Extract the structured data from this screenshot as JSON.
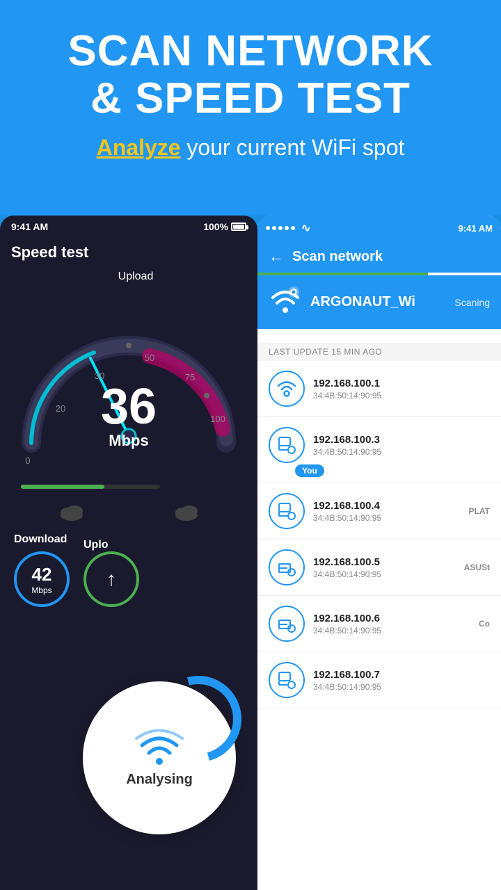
{
  "banner": {
    "title_line1": "SCAN NETWORK",
    "title_line2": "& SPEED TEST",
    "subtitle_highlight": "Analyze",
    "subtitle_rest": " your current WiFi spot"
  },
  "left_phone": {
    "status_time": "9:41 AM",
    "status_battery": "100%",
    "header": "Speed test",
    "upload_label": "Upload",
    "speed_value": "36",
    "speed_unit": "Mbps",
    "download_label": "Download",
    "download_value": "42",
    "download_unit": "Mbps",
    "upload_section_label": "Uplo",
    "analysing_text": "Analysing"
  },
  "right_phone": {
    "status_time": "9:41 AM",
    "header_title": "Scan network",
    "network_name": "ARGONAUT_Wi",
    "scanning_status": "Scaning",
    "last_update": "LAST UPDATE 15 MIN AGO",
    "devices": [
      {
        "ip": "192.168.100.1",
        "mac": "34:4B:50:14:90:95",
        "tag": "",
        "type": "router",
        "you": false
      },
      {
        "ip": "192.168.100.3",
        "mac": "34:4B:50:14:90:95",
        "tag": "",
        "type": "computer",
        "you": true
      },
      {
        "ip": "192.168.100.4",
        "mac": "34:4B:50:14:90:95",
        "tag": "PLAT",
        "type": "computer",
        "you": false
      },
      {
        "ip": "192.168.100.5",
        "mac": "34:4B:50:14:90:95",
        "tag": "ASUSt",
        "type": "computer",
        "you": false
      },
      {
        "ip": "192.168.100.6",
        "mac": "34:4B:50:14:90:95",
        "tag": "Co",
        "type": "computer",
        "you": false
      },
      {
        "ip": "192.168.100.7",
        "mac": "34:4B:50:14:90:95",
        "tag": "",
        "type": "computer",
        "you": false
      }
    ]
  },
  "icons": {
    "back_arrow": "←",
    "wifi": "WiFi",
    "you_label": "You"
  }
}
